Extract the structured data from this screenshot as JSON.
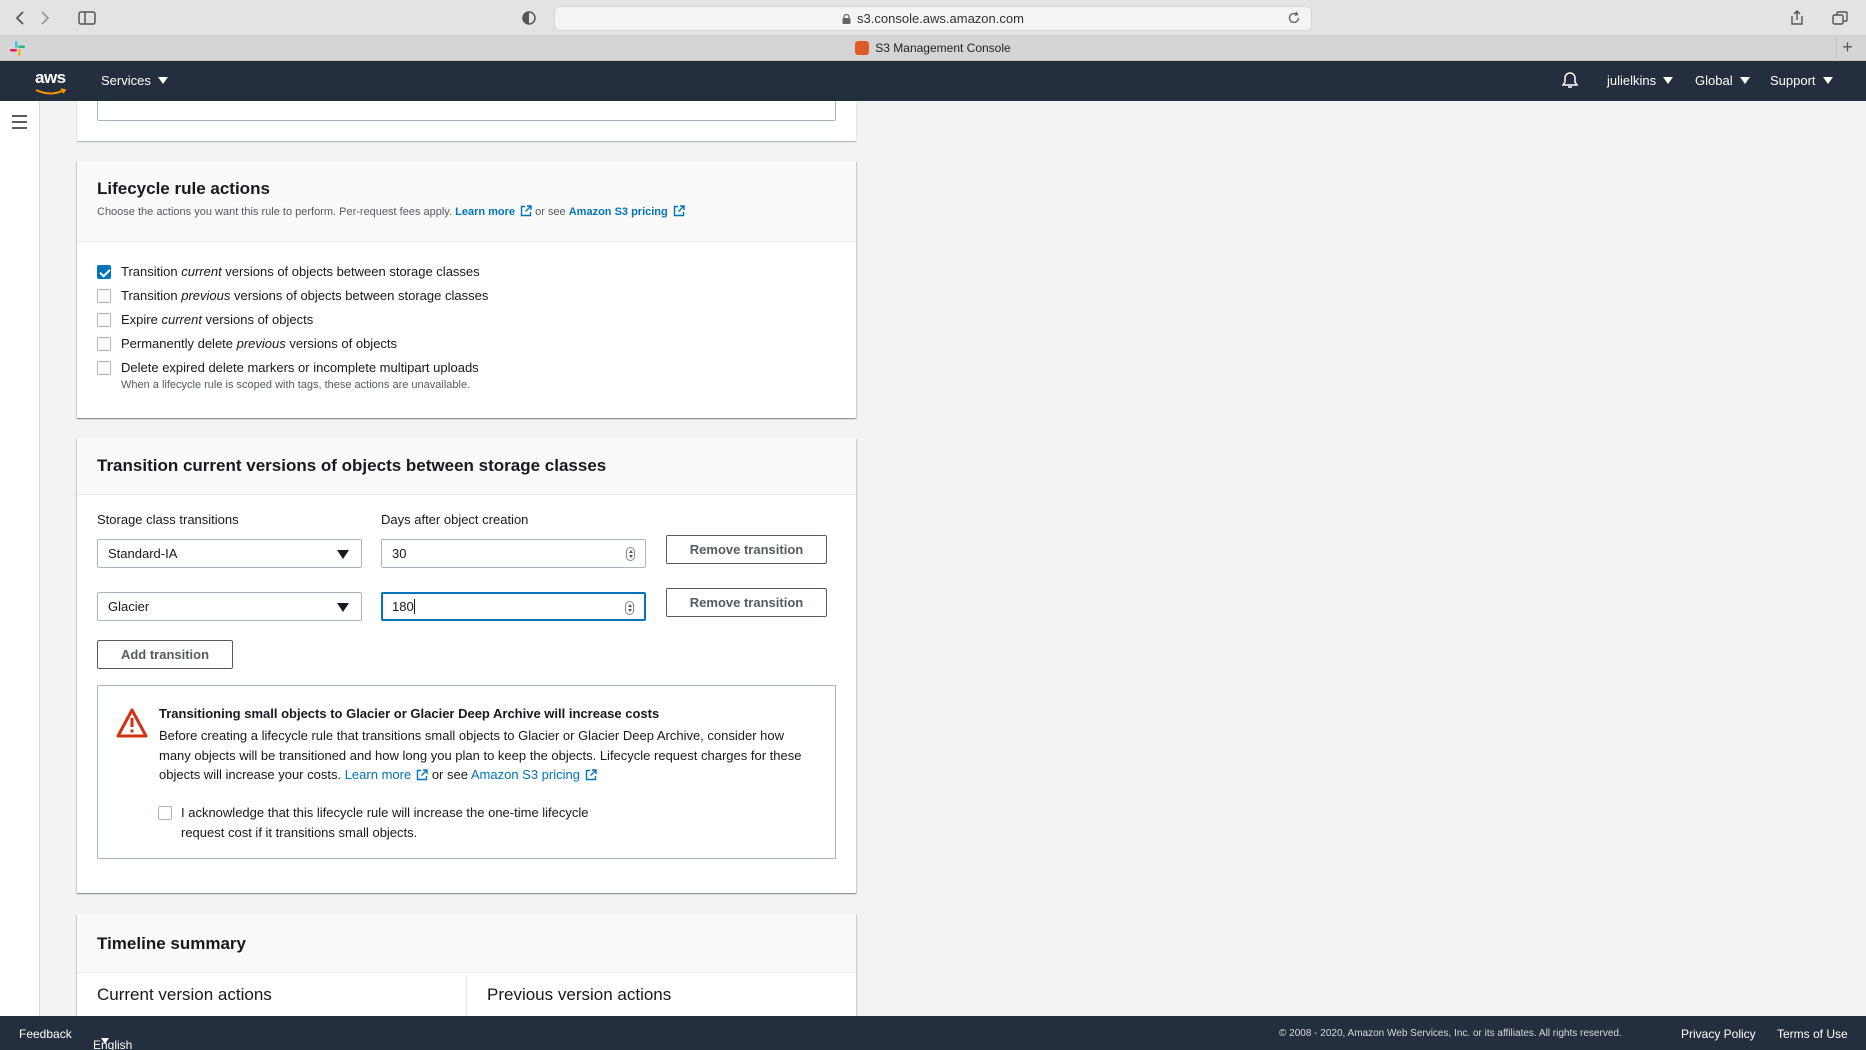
{
  "browser": {
    "url": "s3.console.aws.amazon.com",
    "tab_title": "S3 Management Console"
  },
  "nav": {
    "services_label": "Services",
    "user_label": "julielkins",
    "region_label": "Global",
    "support_label": "Support"
  },
  "lifecycle": {
    "title": "Lifecycle rule actions",
    "desc_prefix": "Choose the actions you want this rule to perform. Per-request fees apply.",
    "learn_more": "Learn more",
    "or_see": "or see",
    "pricing_link": "Amazon S3 pricing",
    "options": [
      {
        "before": "Transition ",
        "em": "current",
        "after": " versions of objects between storage classes",
        "checked": true
      },
      {
        "before": "Transition ",
        "em": "previous",
        "after": " versions of objects between storage classes",
        "checked": false
      },
      {
        "before": "Expire ",
        "em": "current",
        "after": " versions of objects",
        "checked": false
      },
      {
        "before": "Permanently delete ",
        "em": "previous",
        "after": " versions of objects",
        "checked": false
      },
      {
        "before": "Delete expired delete markers or incomplete multipart uploads",
        "em": "",
        "after": "",
        "checked": false
      }
    ],
    "option_note": "When a lifecycle rule is scoped with tags, these actions are unavailable."
  },
  "transition": {
    "title": "Transition current versions of objects between storage classes",
    "storage_label": "Storage class transitions",
    "days_label": "Days after object creation",
    "rows": [
      {
        "storage_class": "Standard-IA",
        "days": "30",
        "remove_label": "Remove transition"
      },
      {
        "storage_class": "Glacier",
        "days": "180",
        "remove_label": "Remove transition"
      }
    ],
    "add_label": "Add transition",
    "warning": {
      "title": "Transitioning small objects to Glacier or Glacier Deep Archive will increase costs",
      "text": "Before creating a lifecycle rule that transitions small objects to Glacier or Glacier Deep Archive, consider how many objects will be transitioned and how long you plan to keep the objects. Lifecycle request charges for these objects will increase your costs.",
      "learn_more": "Learn more",
      "or_see": "or see",
      "pricing_link": "Amazon S3 pricing",
      "ack_line1": "I acknowledge that this lifecycle rule will increase the one-time lifecycle",
      "ack_line2": "request cost if it transitions small objects."
    }
  },
  "timeline": {
    "title": "Timeline summary",
    "current_label": "Current version actions",
    "previous_label": "Previous version actions"
  },
  "footer": {
    "feedback": "Feedback",
    "language": "English (US)",
    "copyright": "© 2008 - 2020, Amazon Web Services, Inc. or its affiliates. All rights reserved.",
    "privacy": "Privacy Policy",
    "terms": "Terms of Use"
  },
  "colors": {
    "nav_bg": "#232f3e",
    "link": "#0073bb",
    "warning_red": "#d13212"
  }
}
